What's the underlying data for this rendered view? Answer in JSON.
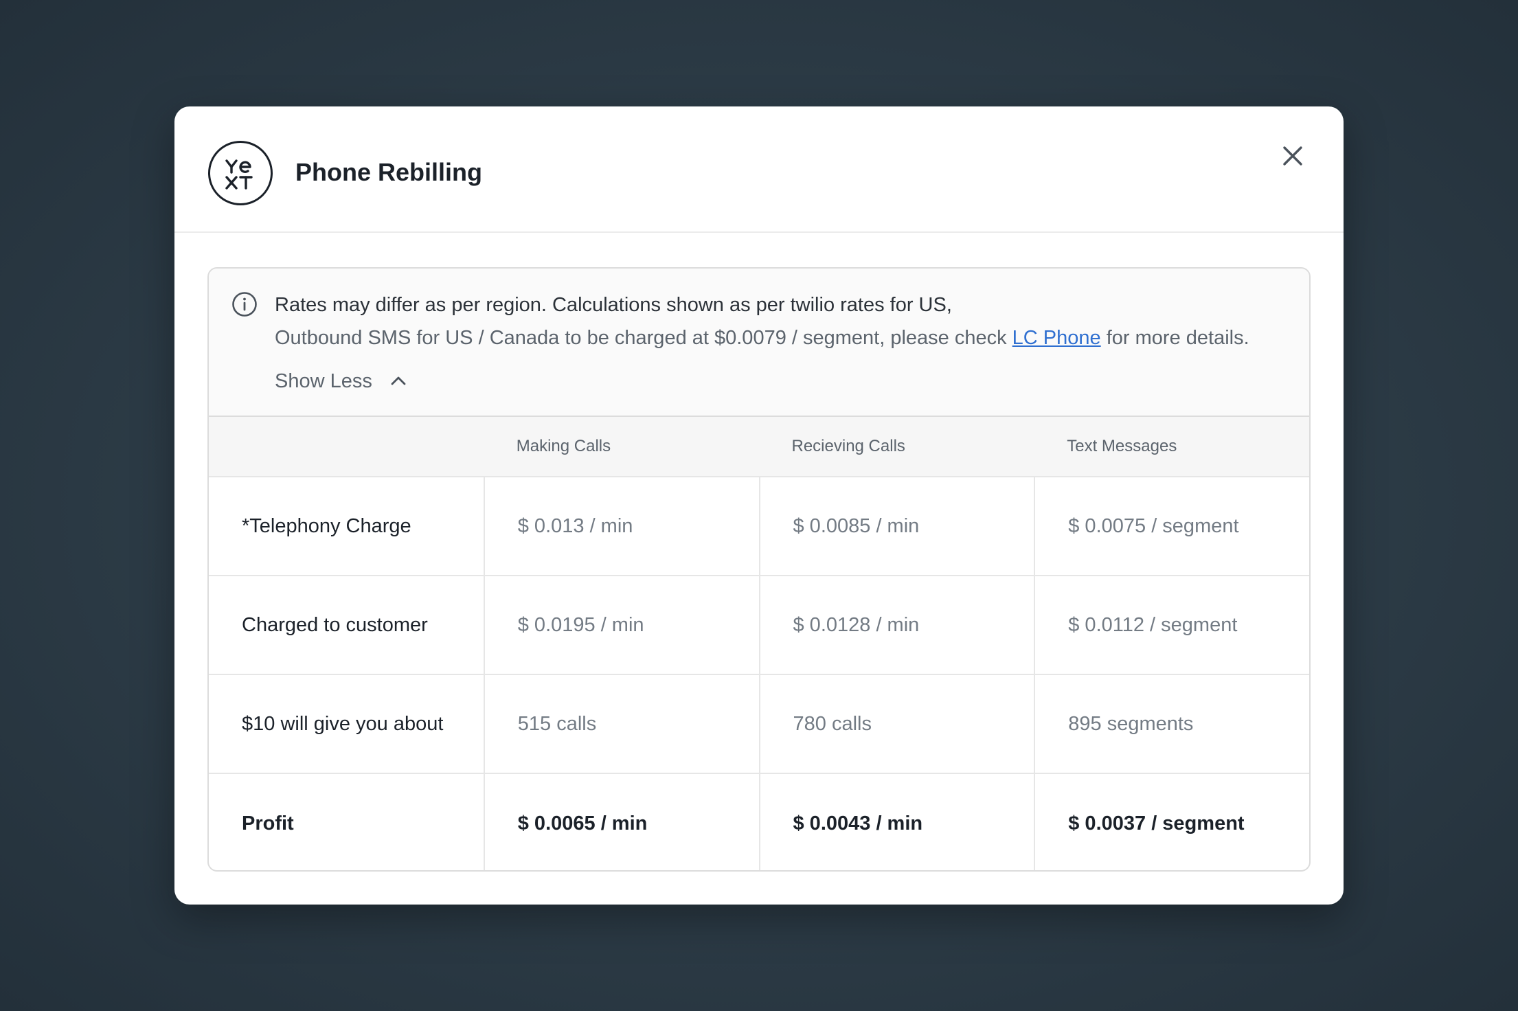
{
  "modal": {
    "title": "Phone Rebilling",
    "logo_icon": "yext-logo-icon",
    "close_icon": "close-icon"
  },
  "info": {
    "icon": "info-circle-icon",
    "line1": "Rates may differ as per region. Calculations shown as per twilio rates for US,",
    "line2_before": "Outbound SMS for US / Canada to be charged at $0.0079 / segment, please check ",
    "link_text": "LC Phone",
    "line2_after": " for more details.",
    "toggle_label": "Show Less",
    "toggle_icon": "chevron-up-icon"
  },
  "table": {
    "headers": [
      "",
      "Making Calls",
      "Recieving Calls",
      "Text Messages"
    ],
    "rows": [
      {
        "label": "*Telephony Charge",
        "values": [
          "$ 0.013 / min",
          "$ 0.0085 / min",
          "$ 0.0075 / segment"
        ]
      },
      {
        "label": "Charged to customer",
        "values": [
          "$ 0.0195 / min",
          "$ 0.0128 / min",
          "$ 0.0112 / segment"
        ]
      },
      {
        "label": "$10 will give you about",
        "values": [
          "515 calls",
          "780 calls",
          "895 segments"
        ]
      },
      {
        "label": "Profit",
        "values": [
          "$ 0.0065 / min",
          "$ 0.0043 / min",
          "$ 0.0037 / segment"
        ]
      }
    ]
  },
  "colors": {
    "backdrop": "#2c3b46",
    "link": "#2f6fd0",
    "text_primary": "#1b2129",
    "text_muted": "#737b84"
  }
}
